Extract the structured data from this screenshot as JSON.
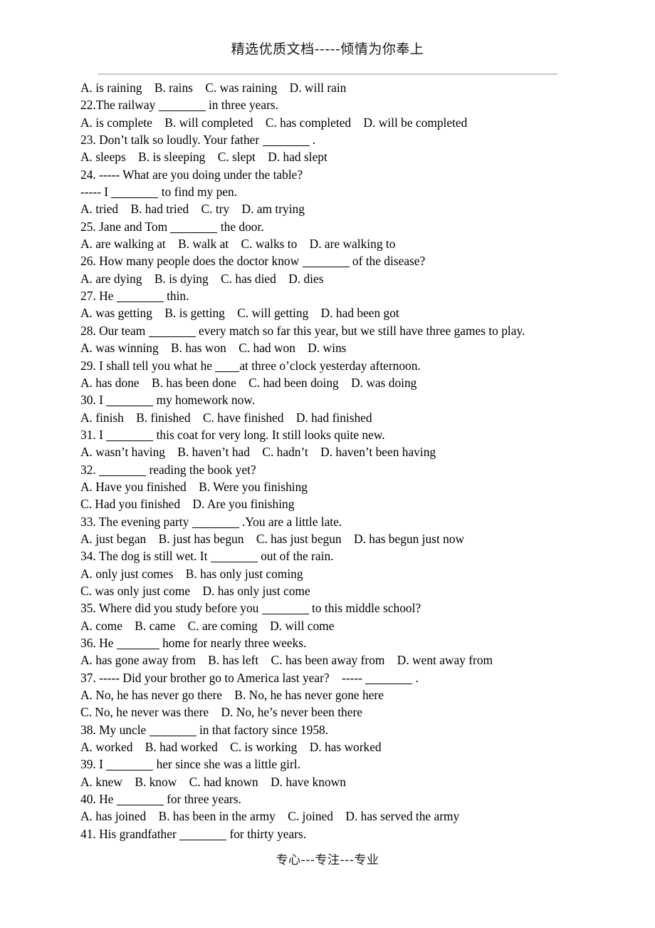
{
  "page": {
    "header_text": "精选优质文档-----倾情为你奉上",
    "footer_text": "专心---专注---专业",
    "rule_color": "#c9c6cc",
    "text_color": "#000000",
    "background_color": "#ffffff"
  },
  "lines": [
    {
      "id": "l01",
      "kind": "options",
      "pre": "A. is raining    B. rains    C. was raining    D. will rain",
      "blank": "",
      "post": ""
    },
    {
      "id": "l02",
      "kind": "question",
      "pre": "22.The railway ",
      "blank": "long",
      "post": " in three years."
    },
    {
      "id": "l03",
      "kind": "options",
      "pre": "A. is complete    B. will completed    C. has completed    D. will be completed",
      "blank": "",
      "post": ""
    },
    {
      "id": "l04",
      "kind": "question",
      "pre": "23. Don’t talk so loudly. Your father ",
      "blank": "long",
      "post": " ."
    },
    {
      "id": "l05",
      "kind": "options",
      "pre": "A. sleeps    B. is sleeping    C. slept    D. had slept",
      "blank": "",
      "post": ""
    },
    {
      "id": "l06",
      "kind": "question",
      "pre": "24. ----- What are you doing under the table?",
      "blank": "",
      "post": ""
    },
    {
      "id": "l07",
      "kind": "question",
      "pre": "----- I ",
      "blank": "long",
      "post": " to find my pen."
    },
    {
      "id": "l08",
      "kind": "options",
      "pre": "A. tried    B. had tried    C. try    D. am trying",
      "blank": "",
      "post": ""
    },
    {
      "id": "l09",
      "kind": "question",
      "pre": "25. Jane and Tom ",
      "blank": "long",
      "post": " the door."
    },
    {
      "id": "l10",
      "kind": "options",
      "pre": "A. are walking at    B. walk at    C. walks to    D. are walking to",
      "blank": "",
      "post": ""
    },
    {
      "id": "l11",
      "kind": "question",
      "pre": "26. How many people does the doctor know ",
      "blank": "long",
      "post": " of the disease?"
    },
    {
      "id": "l12",
      "kind": "options",
      "pre": "A. are dying    B. is dying    C. has died    D. dies",
      "blank": "",
      "post": ""
    },
    {
      "id": "l13",
      "kind": "question",
      "pre": "27. He ",
      "blank": "long",
      "post": " thin."
    },
    {
      "id": "l14",
      "kind": "options",
      "pre": "A. was getting    B. is getting    C. will getting    D. had been got",
      "blank": "",
      "post": ""
    },
    {
      "id": "l15",
      "kind": "question",
      "pre": "28. Our team ",
      "blank": "long",
      "post": " every match so far this year, but we still have three games to play."
    },
    {
      "id": "l16",
      "kind": "options",
      "pre": "A. was winning    B. has won    C. had won    D. wins",
      "blank": "",
      "post": ""
    },
    {
      "id": "l17",
      "kind": "question",
      "pre": "29. I shall tell you what he ",
      "blank": "short",
      "post": "at three o’clock yesterday afternoon."
    },
    {
      "id": "l18",
      "kind": "options",
      "pre": "A. has done    B. has been done    C. had been doing    D. was doing",
      "blank": "",
      "post": ""
    },
    {
      "id": "l19",
      "kind": "question",
      "pre": "30. I ",
      "blank": "long",
      "post": " my homework now."
    },
    {
      "id": "l20",
      "kind": "options",
      "pre": "A. finish    B. finished    C. have finished    D. had finished",
      "blank": "",
      "post": ""
    },
    {
      "id": "l21",
      "kind": "question",
      "pre": "31. I ",
      "blank": "long",
      "post": " this coat for very long. It still looks quite new."
    },
    {
      "id": "l22",
      "kind": "options",
      "pre": "A. wasn’t having    B. haven’t had    C. hadn’t    D. haven’t been having",
      "blank": "",
      "post": ""
    },
    {
      "id": "l23",
      "kind": "question",
      "pre": "32. ",
      "blank": "long",
      "post": " reading the book yet?"
    },
    {
      "id": "l24",
      "kind": "options",
      "pre": "A. Have you finished    B. Were you finishing",
      "blank": "",
      "post": ""
    },
    {
      "id": "l25",
      "kind": "options",
      "pre": "C. Had you finished    D. Are you finishing",
      "blank": "",
      "post": ""
    },
    {
      "id": "l26",
      "kind": "question",
      "pre": "33. The evening party ",
      "blank": "long",
      "post": " .You are a little late."
    },
    {
      "id": "l27",
      "kind": "options",
      "pre": "A. just began    B. just has begun    C. has just begun    D. has begun just now",
      "blank": "",
      "post": ""
    },
    {
      "id": "l28",
      "kind": "question",
      "pre": "34. The dog is still wet. It ",
      "blank": "long",
      "post": " out of the rain."
    },
    {
      "id": "l29",
      "kind": "options",
      "pre": "A. only just comes    B. has only just coming",
      "blank": "",
      "post": ""
    },
    {
      "id": "l30",
      "kind": "options",
      "pre": "C. was only just come    D. has only just come",
      "blank": "",
      "post": ""
    },
    {
      "id": "l31",
      "kind": "question",
      "pre": "35. Where did you study before you ",
      "blank": "long",
      "post": " to this middle school?"
    },
    {
      "id": "l32",
      "kind": "options",
      "pre": "A. come    B. came    C. are coming    D. will come",
      "blank": "",
      "post": ""
    },
    {
      "id": "l33",
      "kind": "question",
      "pre": "36. He ",
      "blank": "med",
      "post": " home for nearly three weeks."
    },
    {
      "id": "l34",
      "kind": "options",
      "pre": "A. has gone away from    B. has left    C. has been away from    D. went away from",
      "blank": "",
      "post": ""
    },
    {
      "id": "l35",
      "kind": "question",
      "pre": "37. ----- Did your brother go to America last year?    ----- ",
      "blank": "long",
      "post": " ."
    },
    {
      "id": "l36",
      "kind": "options",
      "pre": "A. No, he has never go there    B. No, he has never gone here",
      "blank": "",
      "post": ""
    },
    {
      "id": "l37",
      "kind": "options",
      "pre": "C. No, he never was there    D. No, he’s never been there",
      "blank": "",
      "post": ""
    },
    {
      "id": "l38",
      "kind": "question",
      "pre": "38. My uncle ",
      "blank": "long",
      "post": " in that factory since 1958."
    },
    {
      "id": "l39",
      "kind": "options",
      "pre": "A. worked    B. had worked    C. is working    D. has worked",
      "blank": "",
      "post": ""
    },
    {
      "id": "l40",
      "kind": "question",
      "pre": "39. I ",
      "blank": "long",
      "post": " her since she was a little girl."
    },
    {
      "id": "l41",
      "kind": "options",
      "pre": "A. knew    B. know    C. had known    D. have known",
      "blank": "",
      "post": ""
    },
    {
      "id": "l42",
      "kind": "question",
      "pre": "40. He ",
      "blank": "long",
      "post": " for three years."
    },
    {
      "id": "l43",
      "kind": "options",
      "pre": "A. has joined    B. has been in the army    C. joined    D. has served the army",
      "blank": "",
      "post": ""
    },
    {
      "id": "l44",
      "kind": "question",
      "pre": "41. His grandfather ",
      "blank": "long",
      "post": " for thirty years."
    }
  ]
}
